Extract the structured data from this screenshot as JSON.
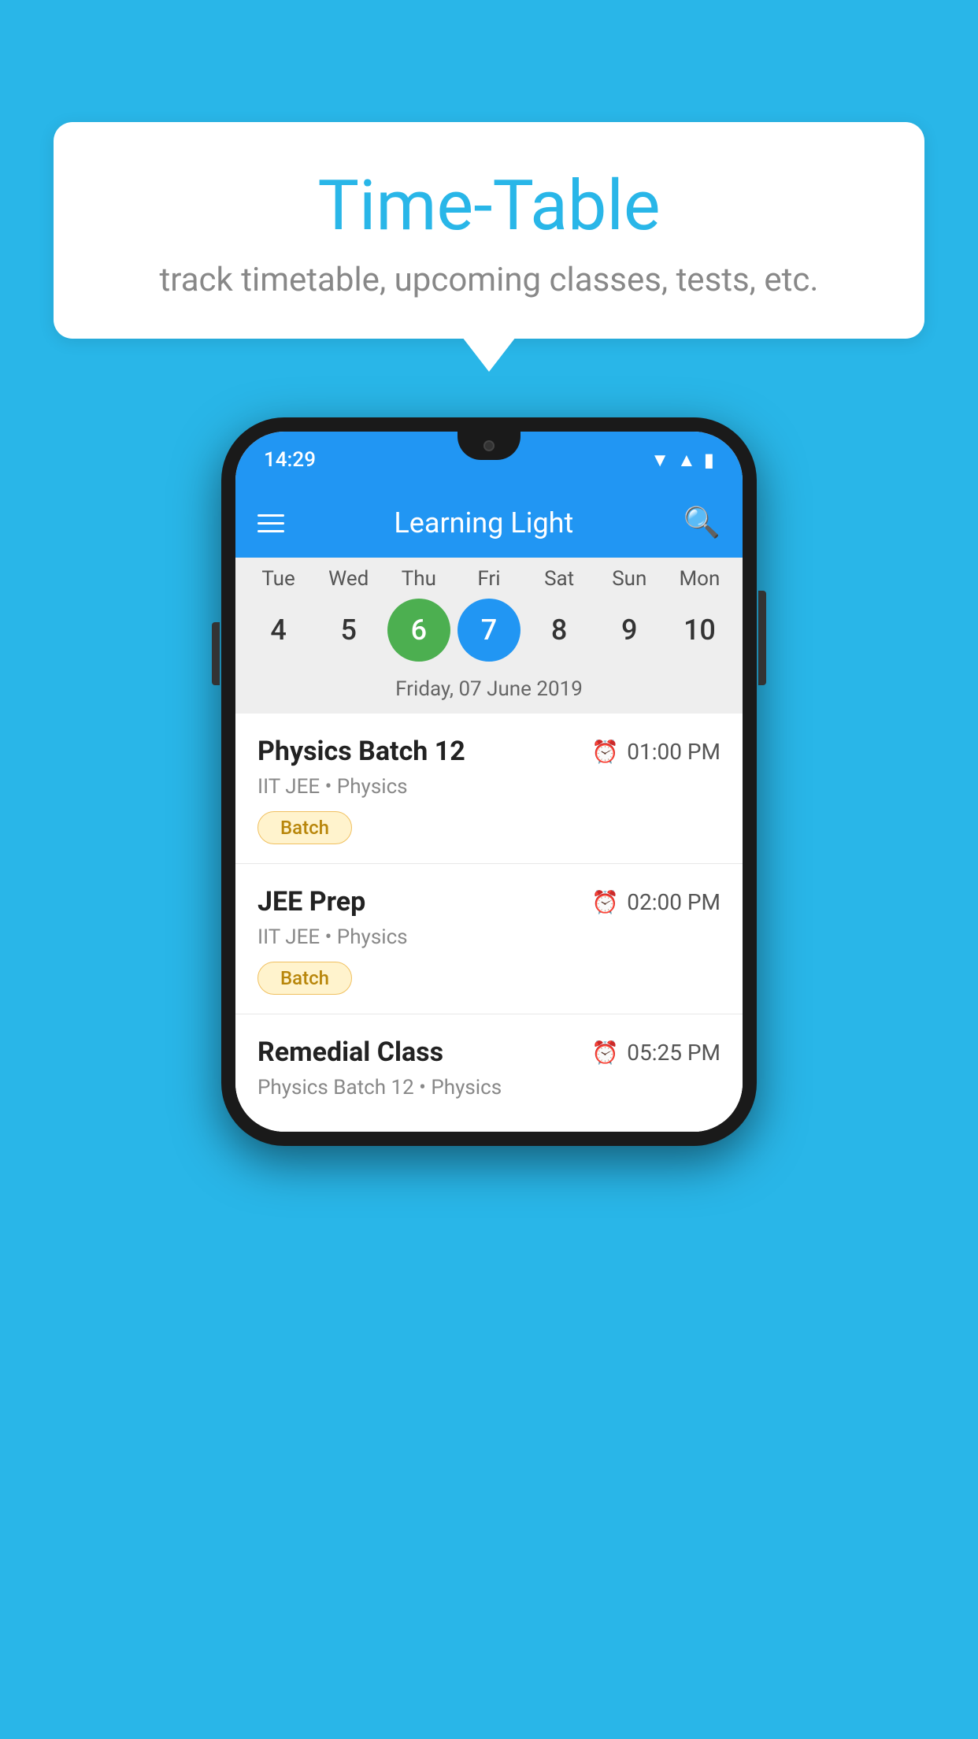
{
  "background": {
    "color": "#29B6E8"
  },
  "speech_bubble": {
    "title": "Time-Table",
    "subtitle": "track timetable, upcoming classes, tests, etc."
  },
  "phone": {
    "status_bar": {
      "time": "14:29"
    },
    "app_header": {
      "title": "Learning Light"
    },
    "calendar": {
      "days": [
        {
          "short": "Tue",
          "num": "4"
        },
        {
          "short": "Wed",
          "num": "5"
        },
        {
          "short": "Thu",
          "num": "6",
          "state": "today"
        },
        {
          "short": "Fri",
          "num": "7",
          "state": "selected"
        },
        {
          "short": "Sat",
          "num": "8"
        },
        {
          "short": "Sun",
          "num": "9"
        },
        {
          "short": "Mon",
          "num": "10"
        }
      ],
      "selected_date_label": "Friday, 07 June 2019"
    },
    "events": [
      {
        "title": "Physics Batch 12",
        "time": "01:00 PM",
        "subtitle": "IIT JEE • Physics",
        "badge": "Batch"
      },
      {
        "title": "JEE Prep",
        "time": "02:00 PM",
        "subtitle": "IIT JEE • Physics",
        "badge": "Batch"
      },
      {
        "title": "Remedial Class",
        "time": "05:25 PM",
        "subtitle": "Physics Batch 12 • Physics",
        "badge": null
      }
    ]
  }
}
